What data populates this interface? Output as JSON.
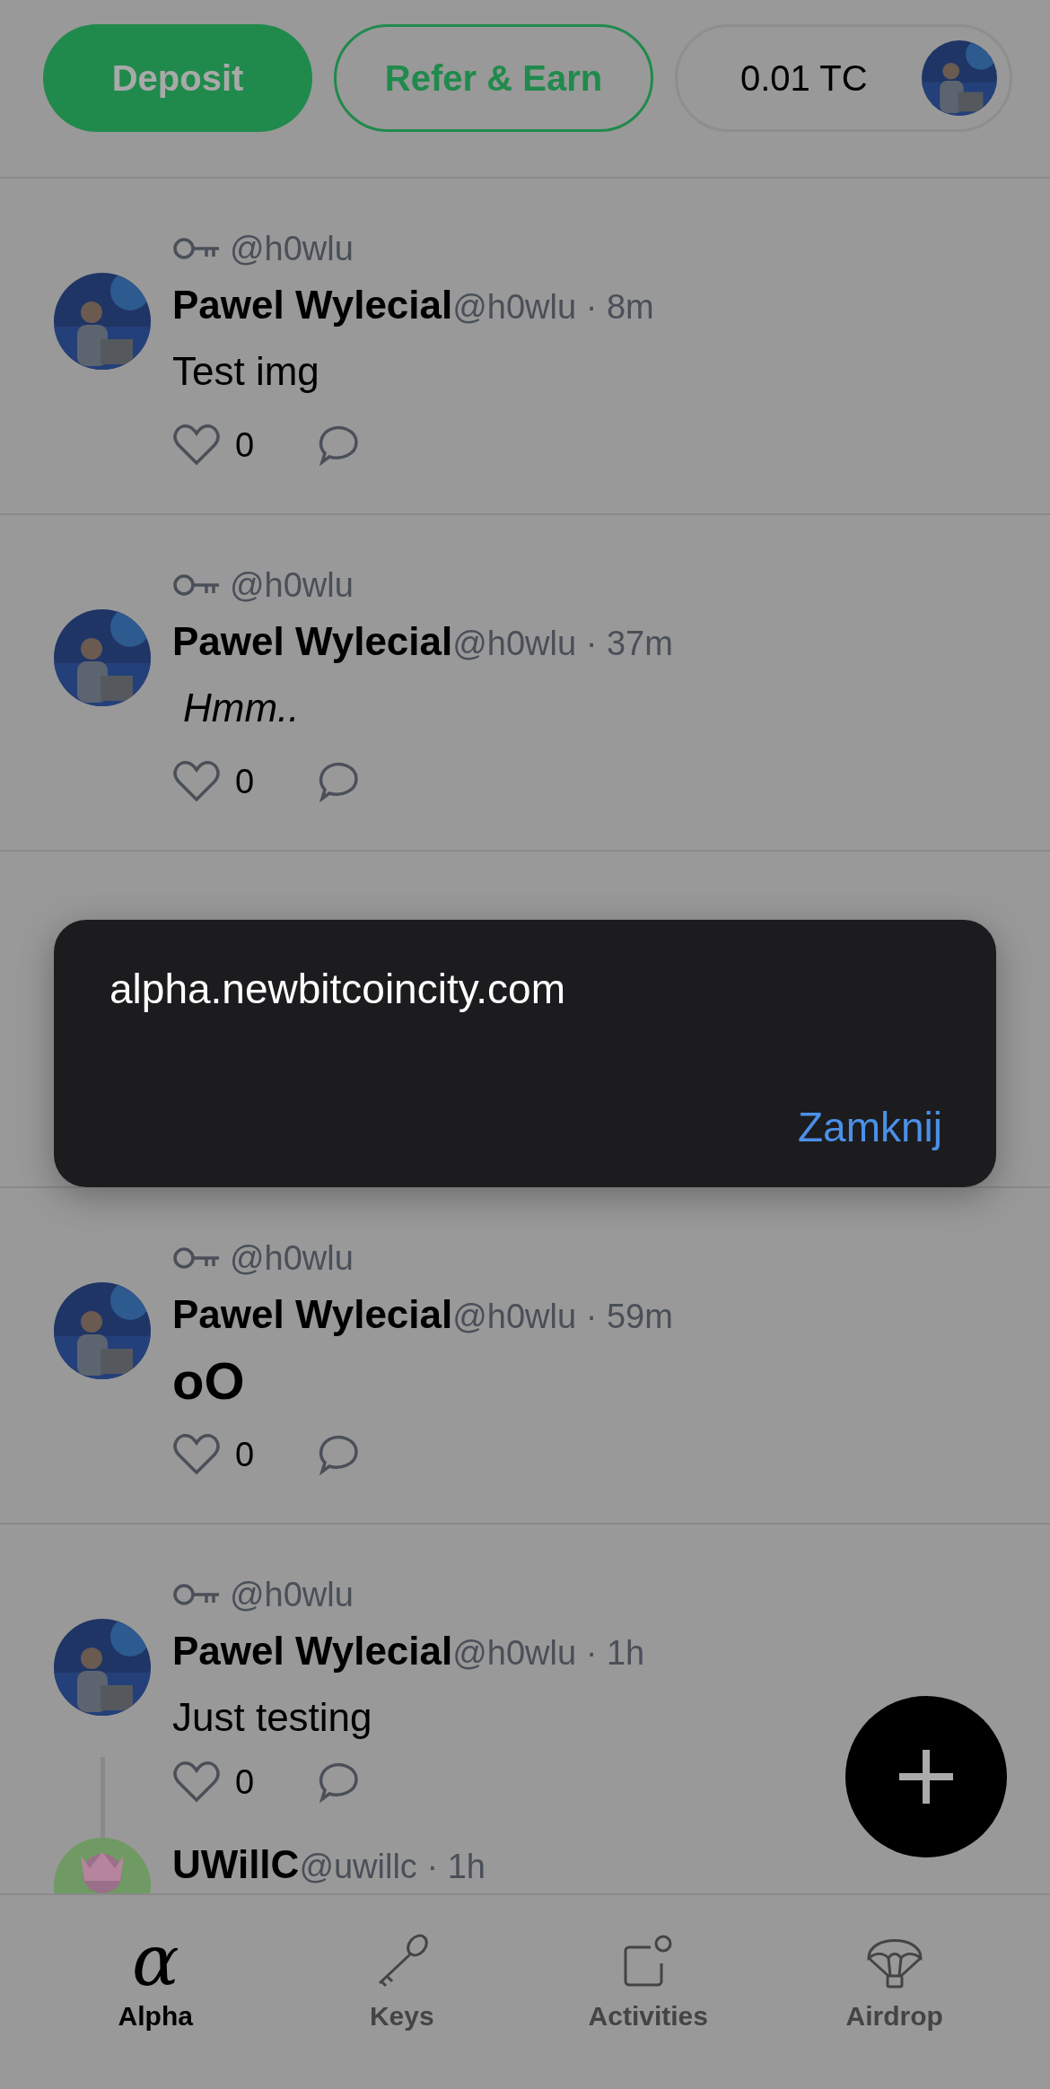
{
  "header": {
    "deposit_button": "Deposit",
    "refer_button": "Refer & Earn",
    "balance": "0.01 TC"
  },
  "posts": [
    {
      "reposter_handle": "@h0wlu",
      "author": "Pawel Wylecial",
      "handle": "@h0wlu",
      "time": "· 8m",
      "text": "Test img",
      "kind": "plain",
      "likes": "0"
    },
    {
      "reposter_handle": "@h0wlu",
      "author": "Pawel Wylecial",
      "handle": "@h0wlu",
      "time": "· 37m",
      "text": "Hmm..",
      "kind": "italic",
      "likes": "0"
    },
    {
      "kind": "covered"
    },
    {
      "reposter_handle": "@h0wlu",
      "author": "Pawel Wylecial",
      "handle": "@h0wlu",
      "time": "· 59m",
      "text": "oO",
      "kind": "large",
      "likes": "0"
    },
    {
      "reposter_handle": "@h0wlu",
      "author": "Pawel Wylecial",
      "handle": "@h0wlu",
      "time": "· 1h",
      "text": "Just testing",
      "kind": "plain",
      "likes": "0",
      "replies": [
        {
          "author": "UWillC",
          "handle": "@uwillc",
          "time": "· 1h"
        }
      ]
    }
  ],
  "dialog": {
    "message": "alpha.newbitcoincity.com",
    "button": "Zamknij"
  },
  "nav": [
    {
      "label": "Alpha",
      "glyph": "α",
      "selected": true
    },
    {
      "label": "Keys",
      "selected": false
    },
    {
      "label": "Activities",
      "selected": false
    },
    {
      "label": "Airdrop",
      "selected": false
    }
  ]
}
